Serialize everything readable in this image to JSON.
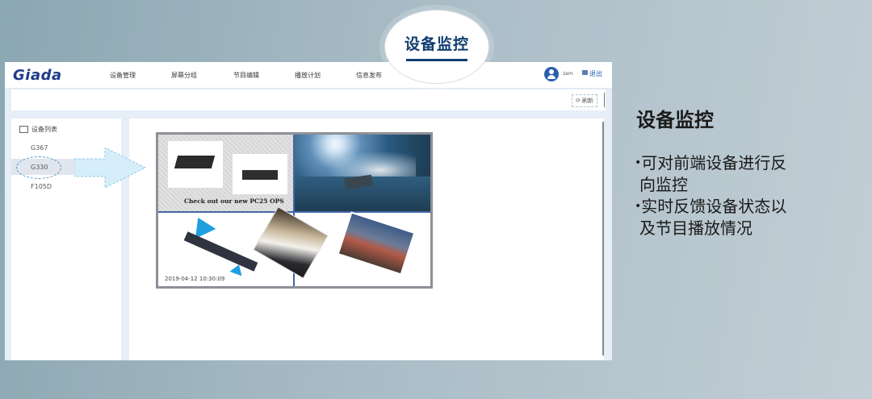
{
  "bubble": {
    "label": "设备监控"
  },
  "app": {
    "logo": "Giada",
    "nav": [
      "设备管理",
      "屏幕分组",
      "节目编辑",
      "播放计划",
      "信息发布"
    ],
    "user_name": "zam",
    "exit_label": "退出",
    "toolbar": {
      "refresh_label": "刷新"
    },
    "sidebar": {
      "title": "设备列表",
      "items": [
        "G367",
        "G330",
        "F105D"
      ],
      "selected": "G330"
    },
    "screen": {
      "promo_text": "Check out our new PC25 OPS",
      "timestamp": "2019-04-12 10:30:09"
    }
  },
  "panel": {
    "title": "设备监控",
    "bullet": "•",
    "lines": [
      "可对前端设备进行反",
      "向监控",
      "实时反馈设备状态以",
      "及节目播放情况"
    ]
  },
  "colors": {
    "accent": "#0f3e6e",
    "nav_blue": "#2a5fb0",
    "arrow": "#d6eefa"
  }
}
